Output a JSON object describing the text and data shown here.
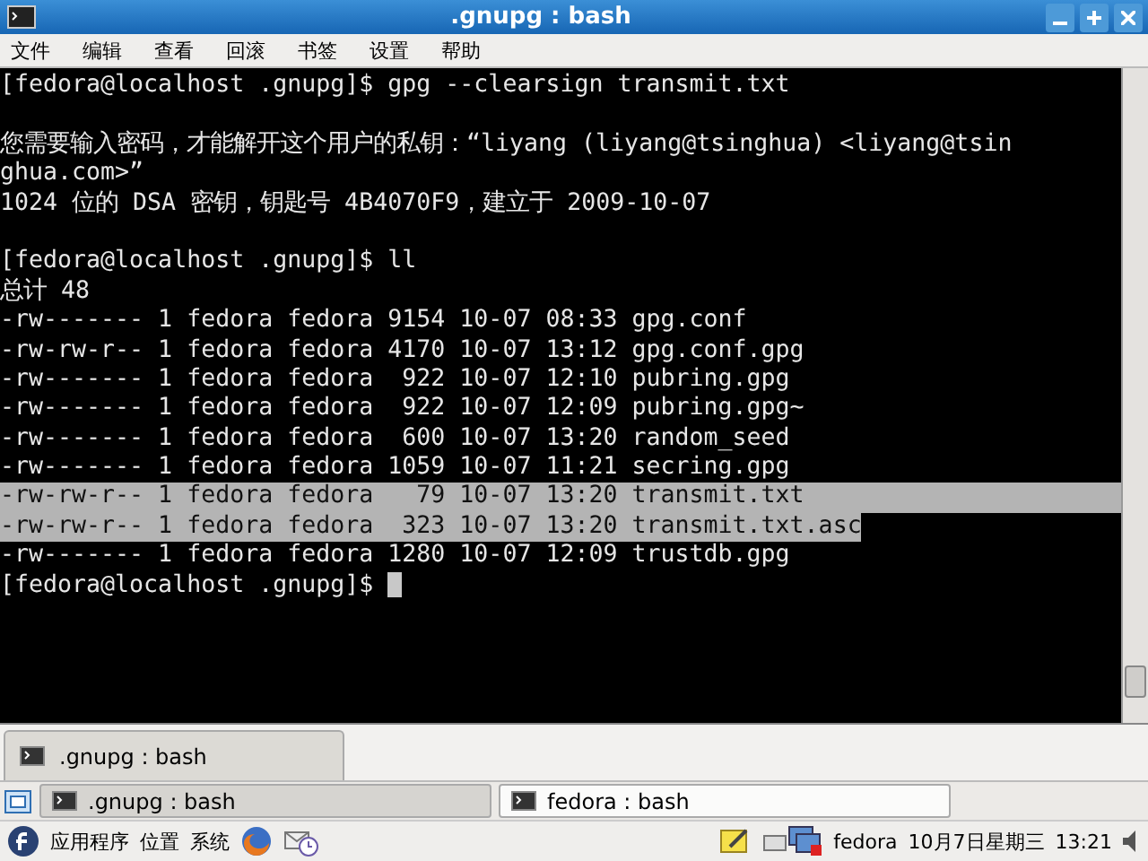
{
  "window": {
    "title": ".gnupg : bash"
  },
  "menu": [
    "文件",
    "编辑",
    "查看",
    "回滚",
    "书签",
    "设置",
    "帮助"
  ],
  "terminal": {
    "lines": [
      {
        "text": "[fedora@localhost .gnupg]$ gpg --clearsign transmit.txt",
        "selected": false
      },
      {
        "selected": false
      },
      {
        "text": "您需要输入密码，才能解开这个用户的私钥：“liyang (liyang@tsinghua) <liyang@tsin",
        "selected": false
      },
      {
        "text": "ghua.com>”",
        "selected": false
      },
      {
        "text": "1024 位的 DSA 密钥，钥匙号 4B4070F9，建立于 2009-10-07",
        "selected": false
      },
      {
        "selected": false
      },
      {
        "text": "[fedora@localhost .gnupg]$ ll",
        "selected": false
      },
      {
        "text": "总计 48",
        "selected": false
      },
      {
        "text": "-rw------- 1 fedora fedora 9154 10-07 08:33 gpg.conf",
        "selected": false
      },
      {
        "text": "-rw-rw-r-- 1 fedora fedora 4170 10-07 13:12 gpg.conf.gpg",
        "selected": false
      },
      {
        "text": "-rw------- 1 fedora fedora  922 10-07 12:10 pubring.gpg",
        "selected": false
      },
      {
        "text": "-rw------- 1 fedora fedora  922 10-07 12:09 pubring.gpg~",
        "selected": false
      },
      {
        "text": "-rw------- 1 fedora fedora  600 10-07 13:20 random_seed",
        "selected": false
      },
      {
        "text": "-rw------- 1 fedora fedora 1059 10-07 11:21 secring.gpg",
        "selected": false
      },
      {
        "text": "-rw-rw-r-- 1 fedora fedora   79 10-07 13:20 transmit.txt",
        "selected": true
      },
      {
        "text": "-rw-rw-r-- 1 fedora fedora  323 10-07 13:20 transmit.txt.asc",
        "selected": true
      },
      {
        "text": "-rw------- 1 fedora fedora 1280 10-07 12:09 trustdb.gpg",
        "selected": false
      },
      {
        "text": "[fedora@localhost .gnupg]$",
        "selected": false,
        "cursor": true
      }
    ]
  },
  "tabs": [
    {
      "label": ".gnupg : bash",
      "selected": true
    }
  ],
  "taskbar": [
    {
      "label": ".gnupg : bash",
      "selected": true
    },
    {
      "label": "fedora : bash",
      "selected": false
    }
  ],
  "panel": {
    "menus": [
      "应用程序",
      "位置",
      "系统"
    ],
    "user": "fedora",
    "date": "10月7日星期三",
    "time": "13:21"
  }
}
